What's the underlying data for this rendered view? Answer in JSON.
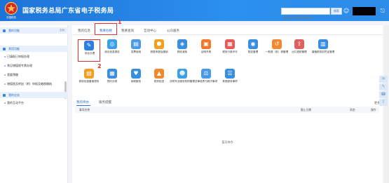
{
  "header": {
    "title": "国家税务总局广东省电子税务局",
    "emblem_text": "中国税务",
    "search_placeholder": "请输入您要搜索的内容",
    "search_button": "搜索"
  },
  "sidebar": {
    "section1": {
      "label": "我的功能",
      "action": "定制"
    },
    "section2": {
      "label": "常用功能"
    },
    "items": [
      "已填报已申报办理",
      "常见增值税专票办理",
      "我要预缴",
      "增值税及附加（附）申报及缴税缴纳"
    ],
    "section3": {
      "label": "我的业务"
    },
    "items2": [
      "我的互动平台"
    ]
  },
  "tabs": [
    "我的信息",
    "我要办税",
    "我要查询",
    "互动中心",
    "公众服务"
  ],
  "active_tab": "我要办税",
  "markers": {
    "one": "1",
    "two": "2"
  },
  "functions": [
    {
      "label": "综合办理",
      "icon": "pen-icon",
      "color": "#2f7fe0"
    },
    {
      "label": "综合信息报告",
      "icon": "globe-icon",
      "color": "#3aa0e8"
    },
    {
      "label": "发票使用",
      "icon": "invoice-icon",
      "color": "#4a9ae8"
    },
    {
      "label": "税费申报及缴纳",
      "icon": "hexagon-icon",
      "color": "#f0a020"
    },
    {
      "label": "税收减免",
      "icon": "shield-icon",
      "color": "#3a8ee0"
    },
    {
      "label": "证明开具",
      "icon": "certificate-icon",
      "color": "#f07828"
    },
    {
      "label": "税务行政许可",
      "icon": "stamp-icon",
      "color": "#e85a5a"
    },
    {
      "label": "核定管理",
      "icon": "target-icon",
      "color": "#3a8ee0"
    },
    {
      "label": "一般退（抵）税管理",
      "icon": "refund-icon",
      "color": "#f08a30"
    },
    {
      "label": "出口退税管理",
      "icon": "export-icon",
      "color": "#e06060"
    },
    {
      "label": "增值税抵扣凭证管理",
      "icon": "document-icon",
      "color": "#3a8ee0"
    },
    {
      "label": "税收优惠备案资料",
      "icon": "folder-icon",
      "color": "#f0a020"
    },
    {
      "label": "预约办税",
      "icon": "calendar-icon",
      "color": "#3a8ee0"
    },
    {
      "label": "纳税服务",
      "icon": "heart-icon",
      "color": "#3a8ee0"
    },
    {
      "label": "税务检查",
      "icon": "building-icon",
      "color": "#f08a30"
    },
    {
      "label": "涉税专业服务机构管理",
      "icon": "people-icon",
      "color": "#3aa0e8"
    },
    {
      "label": "法律追责与救济事项",
      "icon": "gavel-icon",
      "color": "#4a9ae8"
    },
    {
      "label": "其他服务事项",
      "icon": "list-icon",
      "color": "#3a8ee0"
    }
  ],
  "lower_tabs": [
    "我的待办",
    "服务提醒"
  ],
  "more_link": "更多",
  "table_headers": [
    "事项名称",
    "截止日期",
    "状态",
    "操作"
  ],
  "empty_text": "暂无待办",
  "colors": {
    "brand": "#1d74d8",
    "highlight": "#e23030"
  }
}
